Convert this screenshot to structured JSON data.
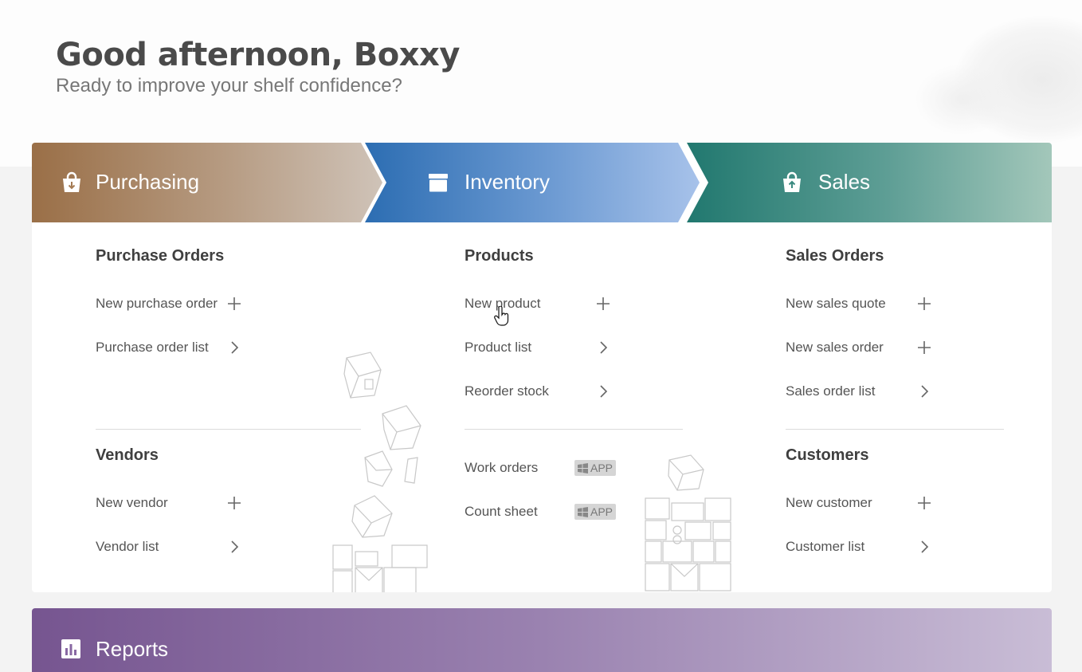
{
  "header": {
    "greeting": "Good afternoon, Boxxy",
    "subtitle": "Ready to improve your shelf confidence?"
  },
  "banners": {
    "purchasing": {
      "label": "Purchasing",
      "icon": "shopping-bag-download-icon",
      "color_start": "#9a6f47",
      "color_end": "#cfc3b8"
    },
    "inventory": {
      "label": "Inventory",
      "icon": "box-icon",
      "color_start": "#2c6db2",
      "color_end": "#a7c2ea"
    },
    "sales": {
      "label": "Sales",
      "icon": "shopping-bag-upload-icon",
      "color_start": "#21786f",
      "color_end": "#a3c7ba"
    }
  },
  "purchasing": {
    "purchase_orders": {
      "title": "Purchase Orders",
      "items": [
        {
          "label": "New purchase order",
          "action": "plus-icon"
        },
        {
          "label": "Purchase order list",
          "action": "chevron-right-icon"
        }
      ]
    },
    "vendors": {
      "title": "Vendors",
      "items": [
        {
          "label": "New vendor",
          "action": "plus-icon"
        },
        {
          "label": "Vendor list",
          "action": "chevron-right-icon"
        }
      ]
    }
  },
  "inventory": {
    "products": {
      "title": "Products",
      "items": [
        {
          "label": "New product",
          "action": "plus-icon"
        },
        {
          "label": "Product list",
          "action": "chevron-right-icon"
        },
        {
          "label": "Reorder stock",
          "action": "chevron-right-icon"
        }
      ]
    },
    "apps": {
      "items": [
        {
          "label": "Work orders",
          "badge": "APP"
        },
        {
          "label": "Count sheet",
          "badge": "APP"
        }
      ]
    }
  },
  "sales": {
    "sales_orders": {
      "title": "Sales Orders",
      "items": [
        {
          "label": "New sales quote",
          "action": "plus-icon"
        },
        {
          "label": "New sales order",
          "action": "plus-icon"
        },
        {
          "label": "Sales order list",
          "action": "chevron-right-icon"
        }
      ]
    },
    "customers": {
      "title": "Customers",
      "items": [
        {
          "label": "New customer",
          "action": "plus-icon"
        },
        {
          "label": "Customer list",
          "action": "chevron-right-icon"
        }
      ]
    }
  },
  "reports": {
    "label": "Reports",
    "icon": "bar-chart-icon",
    "color_start": "#765590",
    "color_end": "#c9bdd6"
  }
}
